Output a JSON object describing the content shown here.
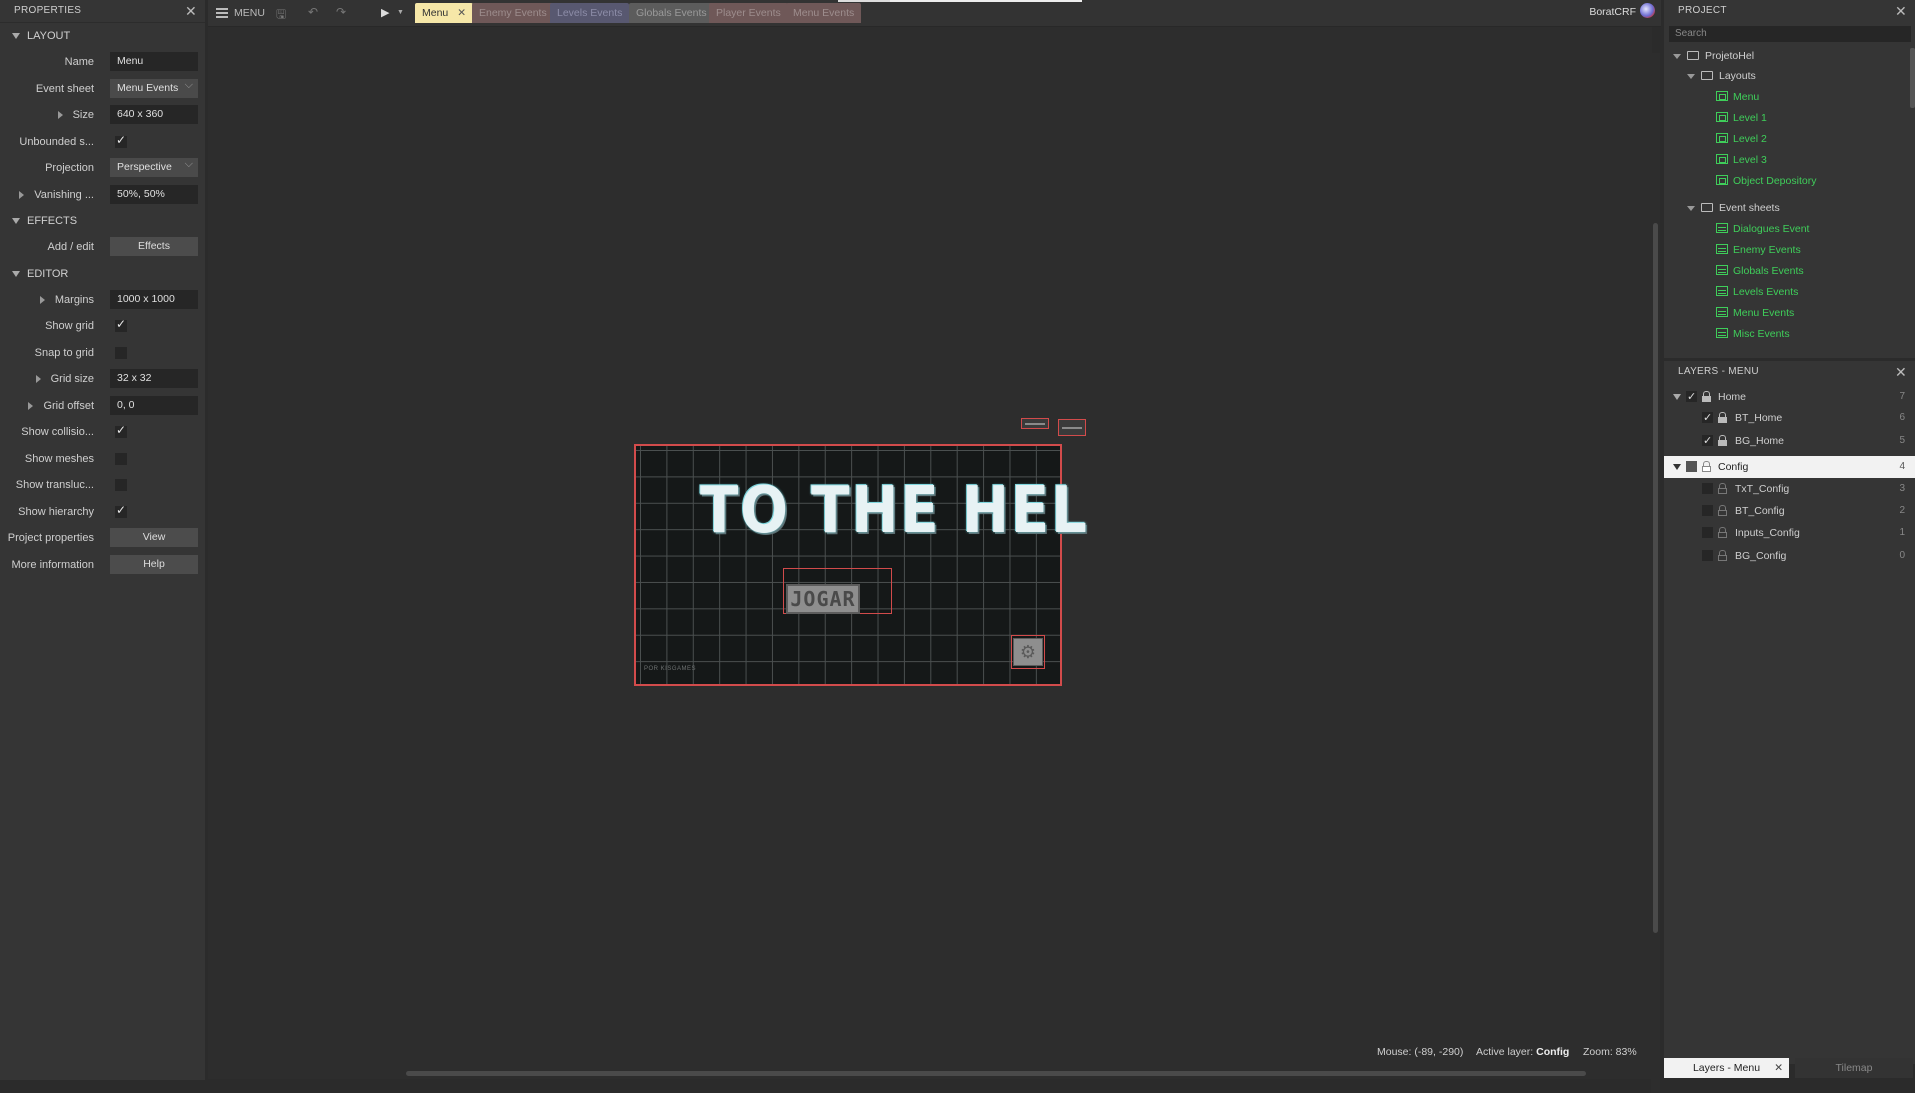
{
  "properties": {
    "title": "PROPERTIES",
    "sections": {
      "layout": "LAYOUT",
      "effects": "EFFECTS",
      "editor": "EDITOR"
    },
    "layout": {
      "name_label": "Name",
      "name_value": "Menu",
      "event_sheet_label": "Event sheet",
      "event_sheet_value": "Menu Events",
      "size_label": "Size",
      "size_value": "640 x 360",
      "unbounded_label": "Unbounded s...",
      "unbounded_checked": true,
      "projection_label": "Projection",
      "projection_value": "Perspective",
      "vanishing_label": "Vanishing ...",
      "vanishing_value": "50%, 50%"
    },
    "effects": {
      "add_edit_label": "Add / edit",
      "effects_button": "Effects"
    },
    "editor": {
      "margins_label": "Margins",
      "margins_value": "1000 x 1000",
      "show_grid_label": "Show grid",
      "show_grid_checked": true,
      "snap_label": "Snap to grid",
      "snap_checked": false,
      "grid_size_label": "Grid size",
      "grid_size_value": "32 x 32",
      "grid_offset_label": "Grid offset",
      "grid_offset_value": "0, 0",
      "show_collision_label": "Show collisio...",
      "show_collision_checked": true,
      "show_meshes_label": "Show meshes",
      "show_meshes_checked": false,
      "show_transluc_label": "Show transluc...",
      "show_transluc_checked": false,
      "show_hierarchy_label": "Show hierarchy",
      "show_hierarchy_checked": true,
      "project_props_label": "Project properties",
      "view_button": "View",
      "more_info_label": "More information",
      "help_button": "Help"
    }
  },
  "toolbar": {
    "menu_label": "MENU",
    "tabs": [
      {
        "label": "Menu",
        "active": true,
        "color": "#f6e7a8"
      },
      {
        "label": "Enemy Events",
        "color": "#7a5d5d"
      },
      {
        "label": "Levels Events",
        "color": "#5d5d7a"
      },
      {
        "label": "Globals Events",
        "color": "#6b6b6b"
      },
      {
        "label": "Player Events",
        "color": "#7a5d5d"
      },
      {
        "label": "Menu Events",
        "color": "#7a5d5d"
      }
    ],
    "user_name": "BoratCRF"
  },
  "canvas": {
    "game_title": "TO THE HEL",
    "play_button": "JOGAR",
    "credit_text": "POR KISGAMES"
  },
  "status": {
    "mouse": "Mouse: (-89, -290)",
    "active_layer_label": "Active layer:",
    "active_layer_value": "Config",
    "zoom": "Zoom: 83%"
  },
  "project": {
    "title": "PROJECT",
    "search_placeholder": "Search",
    "root": "ProjetoHel",
    "layouts_folder": "Layouts",
    "layouts": [
      "Menu",
      "Level 1",
      "Level 2",
      "Level 3",
      "Object Depository"
    ],
    "event_sheets_folder": "Event sheets",
    "event_sheets": [
      "Dialogues Event",
      "Enemy Events",
      "Globals Events",
      "Levels Events",
      "Menu Events",
      "Misc Events"
    ]
  },
  "layers": {
    "title": "LAYERS - MENU",
    "items": [
      {
        "name": "Home",
        "num": "7",
        "checked": true,
        "group": true
      },
      {
        "name": "BT_Home",
        "num": "6",
        "checked": true
      },
      {
        "name": "BG_Home",
        "num": "5",
        "checked": true
      },
      {
        "name": "Config",
        "num": "4",
        "checked": false,
        "group": true,
        "active": true
      },
      {
        "name": "TxT_Config",
        "num": "3",
        "checked": false
      },
      {
        "name": "BT_Config",
        "num": "2",
        "checked": false
      },
      {
        "name": "Inputs_Config",
        "num": "1",
        "checked": false
      },
      {
        "name": "BG_Config",
        "num": "0",
        "checked": false
      }
    ]
  },
  "bottom_tabs": {
    "layers_tab": "Layers - Menu",
    "tilemap_tab": "Tilemap"
  },
  "colors": {
    "accent_green": "#3fce5a",
    "selection_red": "#d24b4b"
  }
}
